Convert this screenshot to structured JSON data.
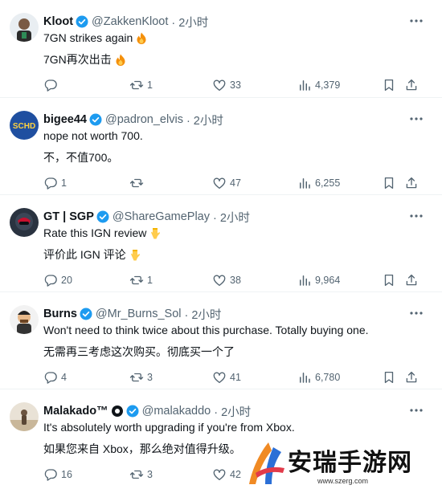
{
  "tweets": [
    {
      "name": "Kloot",
      "handle": "@ZakkenKloot",
      "time": "· 2小时",
      "verified": true,
      "line1": "7GN strikes again",
      "line2": "7GN再次出击",
      "emoji": "fire",
      "replies": "",
      "retweets": "1",
      "likes": "33",
      "views": "4,379"
    },
    {
      "name": "bigee44",
      "handle": "@padron_elvis",
      "time": "· 2小时",
      "verified": true,
      "line1": "nope not worth 700.",
      "line2": "不，不值700。",
      "emoji": "",
      "replies": "1",
      "retweets": "",
      "likes": "47",
      "views": "6,255"
    },
    {
      "name": "GT | SGP",
      "handle": "@ShareGamePlay",
      "time": "· 2小时",
      "verified": true,
      "line1": "Rate this IGN review",
      "line2": "评价此 IGN 评论",
      "emoji": "point-down",
      "replies": "20",
      "retweets": "1",
      "likes": "38",
      "views": "9,964"
    },
    {
      "name": "Burns",
      "handle": "@Mr_Burns_Sol",
      "time": "· 2小时",
      "verified": true,
      "line1": "Won't need to think twice about this purchase. Totally buying one.",
      "line2": "无需再三考虑这次购买。彻底买一个了",
      "emoji": "",
      "replies": "4",
      "retweets": "3",
      "likes": "41",
      "views": "6,780"
    },
    {
      "name": "Malakado™",
      "handle": "@malakaddo",
      "time": "· 2小时",
      "verified": true,
      "line1": "It's absolutely worth upgrading if you're from Xbox.",
      "line2": "如果您来自 Xbox，那么绝对值得升级。",
      "emoji": "",
      "replies": "16",
      "retweets": "3",
      "likes": "42",
      "views": ""
    }
  ],
  "watermark": {
    "text": "安瑞手游网",
    "url": "www.szerg.com"
  },
  "colors": {
    "verified": "#1d9bf0",
    "secondary_text": "#536471",
    "divider": "#eff3f4"
  }
}
